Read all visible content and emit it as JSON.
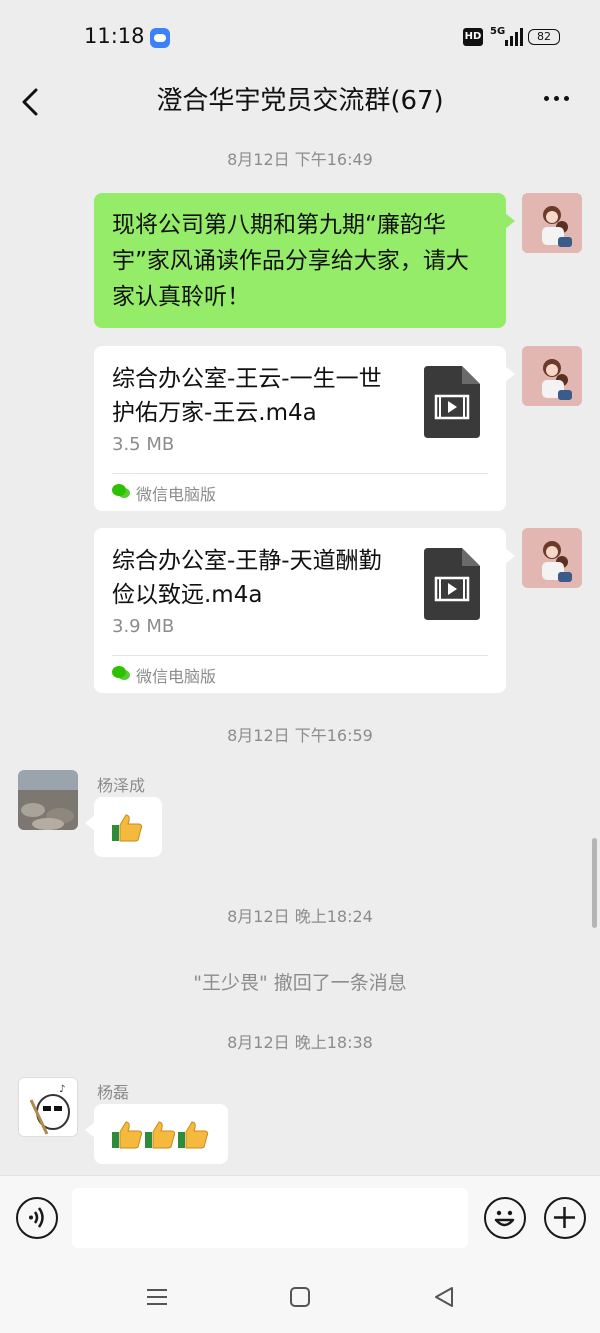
{
  "status_bar": {
    "time": "11:18",
    "hd": "HD",
    "network": "5G",
    "battery": "82"
  },
  "header": {
    "title": "澄合华宇党员交流群(67)"
  },
  "messages": {
    "ts1": "8月12日 下午16:49",
    "text_msg": "现将公司第八期和第九期“廉韵华宇”家风诵读作品分享给大家，请大家认真聆听！",
    "file1": {
      "name": "综合办公室-王云-一生一世护佑万家-王云.m4a",
      "size": "3.5 MB",
      "source": "微信电脑版"
    },
    "file2": {
      "name": "综合办公室-王静-天道酬勤 俭以致远.m4a",
      "size": "3.9 MB",
      "source": "微信电脑版"
    },
    "ts2": "8月12日 下午16:59",
    "sender1": "杨泽成",
    "ts3": "8月12日 晚上18:24",
    "recall": "\"王少畏\" 撤回了一条消息",
    "ts4": "8月12日 晚上18:38",
    "sender2": "杨磊"
  },
  "input_bar": {
    "placeholder": ""
  },
  "colors": {
    "my_bubble": "#95ec69",
    "background": "#ededed"
  }
}
